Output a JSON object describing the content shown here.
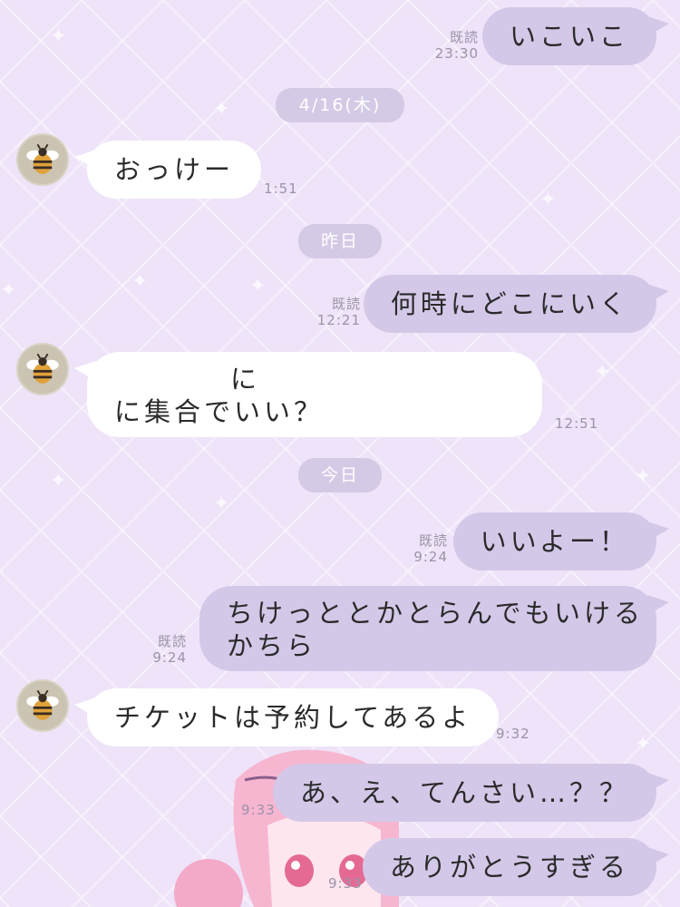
{
  "colors": {
    "background": "#eee3f8",
    "outgoing_bubble": "#d4c8e8",
    "incoming_bubble": "#ffffff",
    "date_pill": "#d5cae6",
    "meta_text": "#9b93a8"
  },
  "contact": {
    "avatar_icon": "bee-icon"
  },
  "messages": [
    {
      "dir": "out",
      "text": "いこいこ",
      "read": "既読",
      "time": "23:30"
    },
    {
      "dir": "in",
      "text": "おっけー",
      "time": "1:51"
    },
    {
      "dir": "out",
      "text": "何時にどこにいく",
      "read": "既読",
      "time": "12:21"
    },
    {
      "dir": "in",
      "line1": "に",
      "line2": "に集合でいい？",
      "time": "12:51"
    },
    {
      "dir": "out",
      "text": "いいよー！",
      "read": "既読",
      "time": "9:24"
    },
    {
      "dir": "out",
      "line1": "ちけっととかとらんでもいける",
      "line2": "かちら",
      "read": "既読",
      "time": "9:24"
    },
    {
      "dir": "in",
      "text": "チケットは予約してあるよ",
      "time": "9:32"
    },
    {
      "dir": "out",
      "text": "あ、え、てんさい…？？",
      "time": "9:33"
    },
    {
      "dir": "out",
      "text": "ありがとうすぎる",
      "time": "9:33"
    }
  ],
  "dates": [
    "4/16(木)",
    "昨日",
    "今日"
  ]
}
